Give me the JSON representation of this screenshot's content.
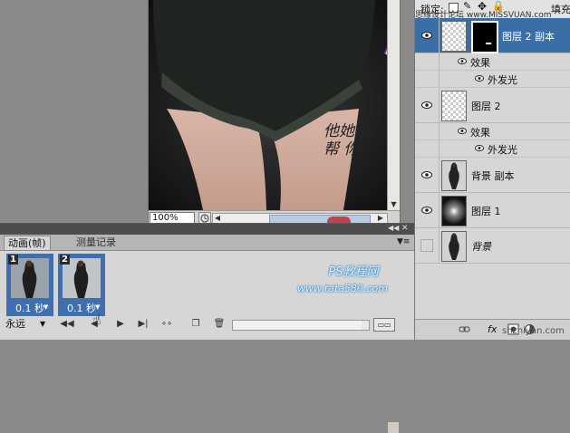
{
  "canvas": {
    "zoom": "100%",
    "calligraphy": "他她 我帮 你"
  },
  "layers_panel": {
    "lock_label": "锁定:",
    "fill_label": "填充",
    "site_watermark": "思缘设计论坛 www.MISSVUAN.com",
    "layers": [
      {
        "name": "图层 2 副本",
        "selected": true,
        "effects_label": "效果",
        "effect_item": "外发光"
      },
      {
        "name": "图层 2",
        "selected": false,
        "effects_label": "效果",
        "effect_item": "外发光"
      },
      {
        "name": "背景 副本",
        "selected": false
      },
      {
        "name": "图层 1",
        "selected": false
      },
      {
        "name": "背景",
        "selected": false,
        "italic": true
      }
    ],
    "bottom_watermark": "shzhiyan.com"
  },
  "animation_panel": {
    "tabs": [
      "动画(帧)",
      "测量记录"
    ],
    "frames": [
      {
        "number": "1",
        "delay": "0.1 秒"
      },
      {
        "number": "2",
        "delay": "0.1 秒"
      }
    ],
    "loop": "永远",
    "watermark_line1": "PS教程网",
    "watermark_line2": "www.tata580.com"
  },
  "colors": {
    "selection": "#3a6ea5",
    "seal_red": "#c81414",
    "panel_bg": "#d6d6d6"
  }
}
